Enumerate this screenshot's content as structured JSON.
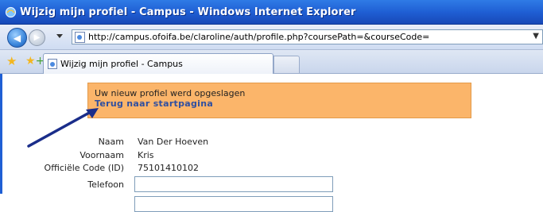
{
  "window": {
    "title": "Wijzig mijn profiel - Campus - Windows Internet Explorer"
  },
  "address": {
    "url": "http://campus.ofoifa.be/claroline/auth/profile.php?coursePath=&courseCode="
  },
  "tab": {
    "label": "Wijzig mijn profiel - Campus"
  },
  "notice": {
    "message": "Uw nieuw profiel werd opgeslagen",
    "link": "Terug naar startpagina",
    "background": "#fbb56a"
  },
  "profile": {
    "naam_label": "Naam",
    "naam_value": "Van Der Hoeven",
    "voornaam_label": "Voornaam",
    "voornaam_value": "Kris",
    "code_label": "Officiële Code (ID)",
    "code_value": "75101410102",
    "telefoon_label": "Telefoon",
    "telefoon_value": ""
  },
  "icons": {
    "browser": "ie-icon",
    "back": "back-arrow-icon",
    "forward": "forward-arrow-icon",
    "page": "page-icon",
    "favorites": "star-icon",
    "add_favorites": "add-favorites-icon"
  },
  "colors": {
    "accent": "#1f5fd4",
    "link": "#2f4fa0",
    "arrow": "#1a2d8a"
  }
}
